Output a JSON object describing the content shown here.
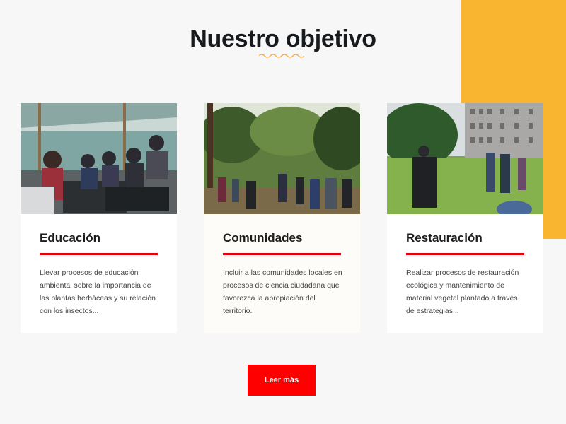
{
  "section": {
    "title": "Nuestro objetivo"
  },
  "cards": [
    {
      "title": "Educación",
      "text": "Llevar procesos de educación ambiental sobre la importancia de las plantas herbáceas y su relación con los insectos...",
      "image": "greenhouse-seedling-workshop-photo"
    },
    {
      "title": "Comunidades",
      "text": "Incluir a las comunidades locales en procesos de ciencia ciudadana que favorezca la apropiación del territorio.",
      "image": "community-group-in-forest-photo"
    },
    {
      "title": "Restauración",
      "text": "Realizar procesos de restauración ecológica y mantenimiento de material vegetal plantado a través de estrategias...",
      "image": "restoration-meeting-near-buildings-photo"
    }
  ],
  "button": {
    "label": "Leer más"
  },
  "colors": {
    "accent_yellow": "#f9b52f",
    "brand_red": "#e5000b",
    "button_red": "#ff0000",
    "background": "#f7f7f7"
  }
}
